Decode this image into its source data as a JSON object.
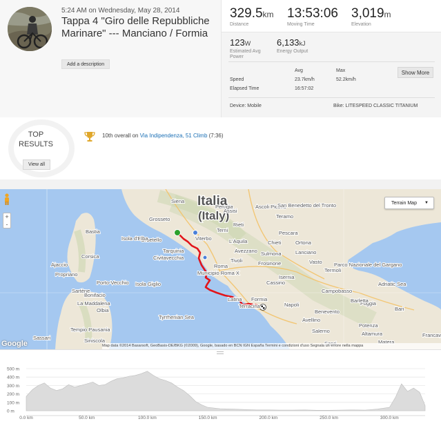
{
  "activity": {
    "date": "5:24 AM on Wednesday, May 28, 2014",
    "title": "Tappa 4 \"Giro delle Repubbliche Marinare\" --- Manciano / Formia",
    "add_description": "Add a description"
  },
  "stats": {
    "distance": {
      "value": "329.5",
      "unit": "km",
      "label": "Distance"
    },
    "moving_time": {
      "value": "13:53:06",
      "label": "Moving Time"
    },
    "elevation": {
      "value": "3,019",
      "unit": "m",
      "label": "Elevation"
    },
    "power": {
      "value": "123",
      "unit": "W",
      "label": "Estimated Avg Power"
    },
    "energy": {
      "value": "6,133",
      "unit": "kJ",
      "label": "Energy Output"
    },
    "table": {
      "col_avg": "Avg",
      "col_max": "Max",
      "speed_label": "Speed",
      "speed_avg": "23.7km/h",
      "speed_max": "52.2km/h",
      "elapsed_label": "Elapsed Time",
      "elapsed_value": "16:57:02"
    },
    "show_more": "Show More",
    "device": "Device: Mobile",
    "bike": "Bike: LITESPEED CLASSIC TITANIUM"
  },
  "results": {
    "top_label_1": "TOP",
    "top_label_2": "RESULTS",
    "view_all": "View all",
    "prefix": "10th overall on ",
    "segment": "Via Indipendenza, 51 Climb",
    "time": "(7:36)"
  },
  "map": {
    "map_type": "Terrain Map",
    "zoom_in": "+",
    "zoom_out": "-",
    "google": "Google",
    "country_1": "Italia",
    "country_2": "(Italy)",
    "credit": "Map data ©2014 Basarsoft, GeoBasis-DE/BKG (©2009), Google, basado en BCN IGN España    Termini e condizioni d'uso    Segnala un errore nella mappa",
    "places": [
      "Grosseto",
      "Siena",
      "Perugia",
      "Assisi",
      "Ascoli Piceno",
      "San Benedetto del Tronto",
      "Teramo",
      "Orbetello",
      "Viterbo",
      "Terni",
      "L'Aquila",
      "Chieti",
      "Pescara",
      "Ortona",
      "Lanciano",
      "Vasto",
      "Tarquinia",
      "Civitavecchia",
      "Rieti",
      "Avezzano",
      "Sulmona",
      "Termoli",
      "Roma",
      "Tivoli",
      "Frosinone",
      "Cassino",
      "Isernia",
      "Campobasso",
      "Latina",
      "Terracina",
      "Formia",
      "Benevento",
      "Napoli",
      "Avellino",
      "Salerno",
      "Sapri",
      "Foggia",
      "Barletta",
      "Bari",
      "Altamura",
      "Potenza",
      "Matera",
      "Francav.",
      "Parco Nazionale del Gargano",
      "Adriatic Sea",
      "Tyrrhenian Sea",
      "Corsica",
      "Bastia",
      "Ajaccio",
      "Propriano",
      "Sartène",
      "Porto-Vecchio",
      "Bonifacio",
      "La Maddalena",
      "Olbia",
      "Tempio Pausania",
      "Sassari",
      "Siniscola",
      "Isola d'Elba",
      "Municipio Roma X",
      "Isola Giglio"
    ]
  },
  "elevation_profile": {
    "y_ticks": [
      "500 m",
      "400 m",
      "300 m",
      "200 m",
      "100 m",
      "0 m"
    ],
    "x_ticks": [
      "0.0 km",
      "50.0 km",
      "100.0 km",
      "150.0 km",
      "200.0 km",
      "250.0 km",
      "300.0 km"
    ],
    "profile_km": [
      0,
      5,
      10,
      15,
      20,
      25,
      30,
      35,
      40,
      45,
      50,
      55,
      60,
      65,
      70,
      75,
      80,
      85,
      90,
      95,
      100,
      105,
      110,
      115,
      120,
      125,
      130,
      135,
      140,
      145,
      150,
      160,
      170,
      180,
      190,
      200,
      210,
      220,
      230,
      240,
      250,
      260,
      270,
      280,
      290,
      300,
      305,
      310,
      315,
      320,
      325,
      329.5
    ],
    "profile_m": [
      170,
      250,
      300,
      330,
      270,
      240,
      260,
      310,
      280,
      300,
      320,
      340,
      300,
      310,
      350,
      380,
      390,
      410,
      420,
      440,
      470,
      420,
      380,
      360,
      330,
      280,
      240,
      180,
      110,
      70,
      40,
      25,
      20,
      15,
      10,
      10,
      8,
      8,
      10,
      6,
      6,
      8,
      10,
      8,
      20,
      40,
      160,
      320,
      230,
      270,
      220,
      60
    ]
  },
  "colors": {
    "route": "#e2151b",
    "link": "#1a6fb5",
    "profile_fill": "#dcdcdc",
    "start_marker": "#2ca02c"
  }
}
